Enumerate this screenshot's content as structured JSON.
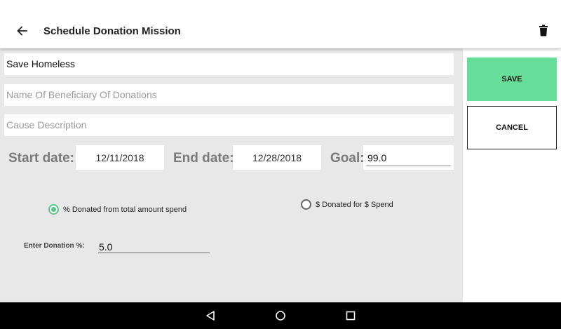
{
  "toolbar": {
    "title": "Schedule Donation Mission",
    "back_icon": "arrow-back-icon",
    "delete_icon": "trash-icon"
  },
  "form": {
    "mission_name": {
      "value": "Save Homeless",
      "placeholder": ""
    },
    "beneficiary": {
      "value": "",
      "placeholder": "Name Of Beneficiary Of Donations"
    },
    "cause": {
      "value": "",
      "placeholder": "Cause Description"
    },
    "start_date": {
      "label": "Start date:",
      "value": "12/11/2018"
    },
    "end_date": {
      "label": "End date:",
      "value": "12/28/2018"
    },
    "goal": {
      "label": "Goal:",
      "value": "99.0"
    },
    "donation_type": {
      "options": [
        {
          "label": "% Donated from total amount spend",
          "selected": true
        },
        {
          "label": "$ Donated for $ Spend",
          "selected": false
        }
      ]
    },
    "donation_percent": {
      "label": "Enter Donation %:",
      "value": "5.0"
    }
  },
  "actions": {
    "save_label": "SAVE",
    "cancel_label": "CANCEL"
  },
  "colors": {
    "accent": "#66dd99",
    "radio_selected": "#5cc68a",
    "form_background": "#e8e8e8",
    "nav_bar": "#000000"
  },
  "navbar": {
    "back_icon": "nav-back-icon",
    "home_icon": "nav-home-icon",
    "recents_icon": "nav-recents-icon"
  }
}
